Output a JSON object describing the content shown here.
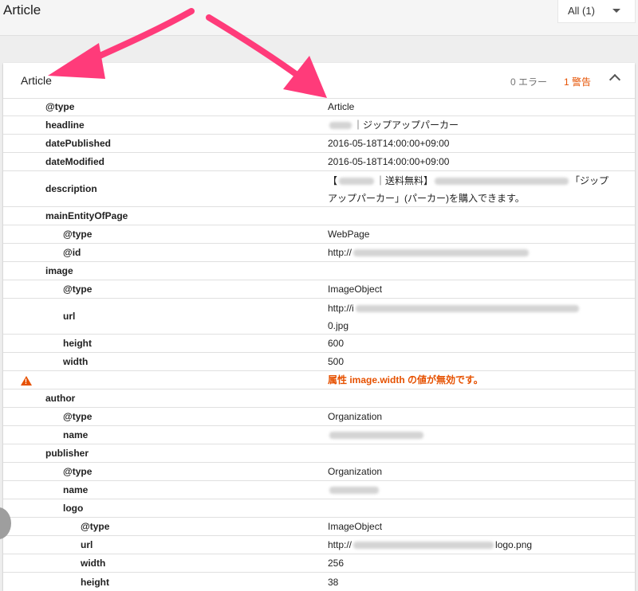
{
  "page": {
    "title": "Article",
    "filter_label": "All (1)"
  },
  "card": {
    "title": "Article",
    "errors": "0 エラー",
    "warnings": "1 警告"
  },
  "colors": {
    "accent_warning": "#e65100",
    "arrow": "#ff3b7a"
  },
  "rows": [
    {
      "key": "@type",
      "value": "Article"
    },
    {
      "key": "headline",
      "value": "｜ジップアップパーカー"
    },
    {
      "key": "datePublished",
      "value": "2016-05-18T14:00:00+09:00"
    },
    {
      "key": "dateModified",
      "value": "2016-05-18T14:00:00+09:00"
    },
    {
      "key": "description",
      "value": "【",
      "value_b": "｜送料無料】",
      "value_c": "「ジップ",
      "value_line2": "アップパーカー」(パーカー)を購入できます。"
    },
    {
      "key": "mainEntityOfPage",
      "value": ""
    },
    {
      "key": "@type",
      "value": "WebPage"
    },
    {
      "key": "@id",
      "value": "http://"
    },
    {
      "key": "image",
      "value": ""
    },
    {
      "key": "@type",
      "value": "ImageObject"
    },
    {
      "key": "url",
      "value": "http://i",
      "value_line2": "0.jpg"
    },
    {
      "key": "height",
      "value": "600"
    },
    {
      "key": "width",
      "value": "500"
    },
    {
      "key": "",
      "value": "属性 image.width の値が無効です。"
    },
    {
      "key": "author",
      "value": ""
    },
    {
      "key": "@type",
      "value": "Organization"
    },
    {
      "key": "name",
      "value": ""
    },
    {
      "key": "publisher",
      "value": ""
    },
    {
      "key": "@type",
      "value": "Organization"
    },
    {
      "key": "name",
      "value": ""
    },
    {
      "key": "logo",
      "value": ""
    },
    {
      "key": "@type",
      "value": "ImageObject"
    },
    {
      "key": "url",
      "value": "http://",
      "value_b": "logo.png"
    },
    {
      "key": "width",
      "value": "256"
    },
    {
      "key": "height",
      "value": "38"
    }
  ]
}
